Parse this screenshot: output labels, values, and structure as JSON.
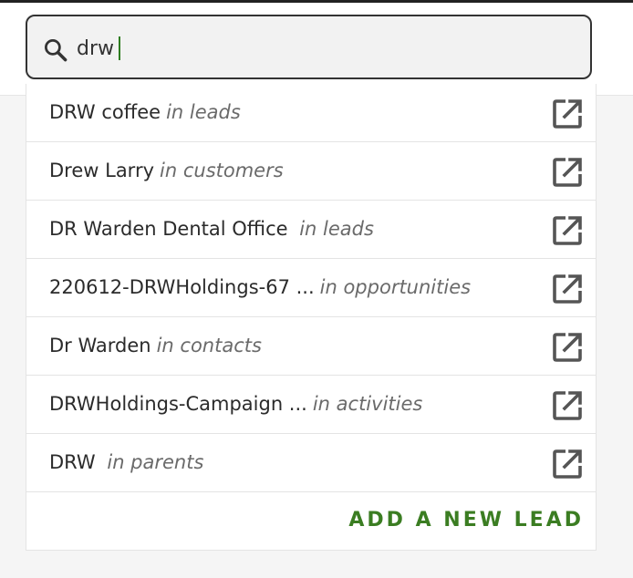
{
  "search": {
    "value": "drw",
    "icon": "search-icon",
    "accent_color": "#2e7d20"
  },
  "results": [
    {
      "name": "DRW coffee",
      "context": "in leads",
      "icon": "open-in-new-icon"
    },
    {
      "name": "Drew Larry",
      "context": "in customers",
      "icon": "open-in-new-icon"
    },
    {
      "name": "DR Warden Dental Office ",
      "context": "in leads",
      "icon": "open-in-new-icon"
    },
    {
      "name": "220612-DRWHoldings-67 ...",
      "context": "in opportunities",
      "icon": "open-in-new-icon"
    },
    {
      "name": "Dr Warden",
      "context": "in contacts",
      "icon": "open-in-new-icon"
    },
    {
      "name": "DRWHoldings-Campaign ...",
      "context": "in activities",
      "icon": "open-in-new-icon"
    },
    {
      "name": "DRW ",
      "context": "in parents",
      "icon": "open-in-new-icon"
    }
  ],
  "add_action": {
    "label": "ADD A NEW LEAD",
    "color": "#3b7d22"
  }
}
